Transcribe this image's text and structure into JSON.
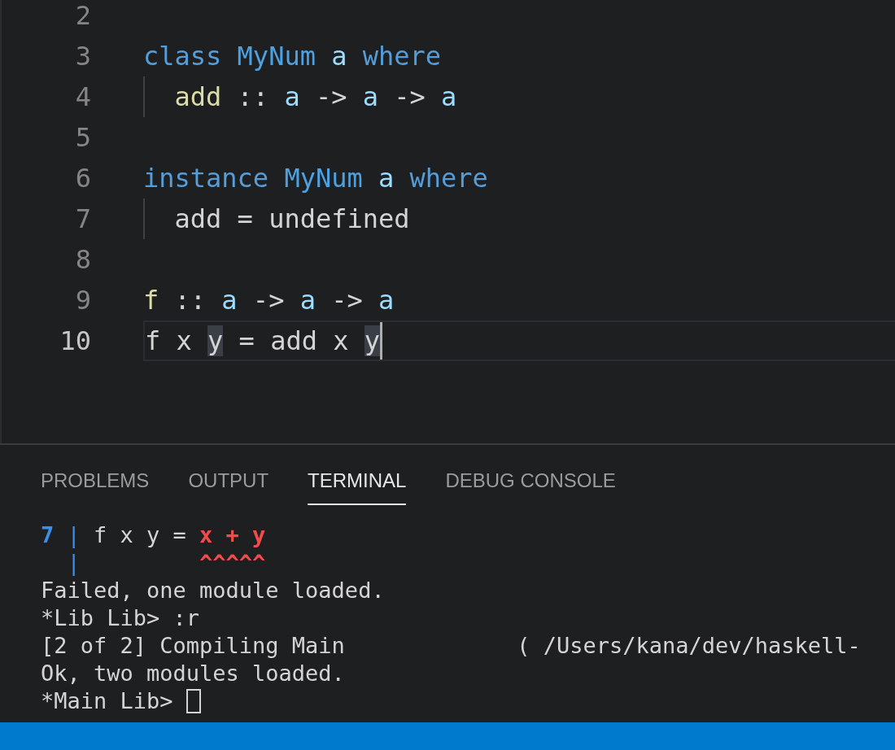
{
  "editor": {
    "lines": [
      {
        "number": "2",
        "current": false,
        "guide": false,
        "cursor": false
      },
      {
        "number": "3",
        "current": false,
        "guide": false,
        "cursor": false,
        "tokens": [
          {
            "text": "class ",
            "kind": "keyword",
            "highlight": false
          },
          {
            "text": "MyNum ",
            "kind": "type",
            "highlight": false
          },
          {
            "text": "a ",
            "kind": "var",
            "highlight": false
          },
          {
            "text": "where",
            "kind": "keyword",
            "highlight": false
          }
        ]
      },
      {
        "number": "4",
        "current": false,
        "guide": true,
        "cursor": false,
        "tokens": [
          {
            "text": "  add",
            "kind": "func",
            "highlight": false
          },
          {
            "text": " :: ",
            "kind": "plain",
            "highlight": false
          },
          {
            "text": "a",
            "kind": "var",
            "highlight": false
          },
          {
            "text": " -> ",
            "kind": "plain",
            "highlight": false
          },
          {
            "text": "a",
            "kind": "var",
            "highlight": false
          },
          {
            "text": " -> ",
            "kind": "plain",
            "highlight": false
          },
          {
            "text": "a",
            "kind": "var",
            "highlight": false
          }
        ]
      },
      {
        "number": "5",
        "current": false,
        "guide": false,
        "cursor": false
      },
      {
        "number": "6",
        "current": false,
        "guide": false,
        "cursor": false,
        "tokens": [
          {
            "text": "instance ",
            "kind": "keyword",
            "highlight": false
          },
          {
            "text": "MyNum ",
            "kind": "type",
            "highlight": false
          },
          {
            "text": "a ",
            "kind": "var",
            "highlight": false
          },
          {
            "text": "where",
            "kind": "keyword",
            "highlight": false
          }
        ]
      },
      {
        "number": "7",
        "current": false,
        "guide": true,
        "cursor": false,
        "tokens": [
          {
            "text": "  add = undefined",
            "kind": "plain",
            "highlight": false
          }
        ]
      },
      {
        "number": "8",
        "current": false,
        "guide": false,
        "cursor": false
      },
      {
        "number": "9",
        "current": false,
        "guide": false,
        "cursor": false,
        "tokens": [
          {
            "text": "f",
            "kind": "func",
            "highlight": false
          },
          {
            "text": " :: ",
            "kind": "plain",
            "highlight": false
          },
          {
            "text": "a",
            "kind": "var",
            "highlight": false
          },
          {
            "text": " -> ",
            "kind": "plain",
            "highlight": false
          },
          {
            "text": "a",
            "kind": "var",
            "highlight": false
          },
          {
            "text": " -> ",
            "kind": "plain",
            "highlight": false
          },
          {
            "text": "a",
            "kind": "var",
            "highlight": false
          }
        ]
      },
      {
        "number": "10",
        "current": true,
        "guide": false,
        "cursor": true,
        "tokens": [
          {
            "text": "f x ",
            "kind": "plain",
            "highlight": false
          },
          {
            "text": "y",
            "kind": "plain",
            "highlight": true
          },
          {
            "text": " = add x ",
            "kind": "plain",
            "highlight": false
          },
          {
            "text": "y",
            "kind": "plain",
            "highlight": true
          }
        ]
      }
    ]
  },
  "panel": {
    "tabs": [
      {
        "label": "PROBLEMS",
        "selected": false
      },
      {
        "label": "OUTPUT",
        "selected": false
      },
      {
        "label": "TERMINAL",
        "selected": true
      },
      {
        "label": "DEBUG CONSOLE",
        "selected": false
      }
    ],
    "terminal": {
      "lines": [
        {
          "tokens": [
            {
              "text": "7 ",
              "kind": "lineno"
            },
            {
              "text": "|",
              "kind": "pipe"
            },
            {
              "text": " f x y = ",
              "kind": "plain"
            },
            {
              "text": "x + y",
              "kind": "error"
            }
          ]
        },
        {
          "tokens": [
            {
              "text": "  |",
              "kind": "pipe"
            },
            {
              "text": "         ^^^^^",
              "kind": "error"
            }
          ]
        },
        {
          "tokens": [
            {
              "text": "Failed, one module loaded.",
              "kind": "plain"
            }
          ]
        },
        {
          "tokens": [
            {
              "text": "*Lib Lib> :r",
              "kind": "plain"
            }
          ]
        },
        {
          "tokens": [
            {
              "text": "[2 of 2] Compiling Main             ( /Users/kana/dev/haskell-",
              "kind": "plain"
            }
          ]
        },
        {
          "tokens": [
            {
              "text": "Ok, two modules loaded.",
              "kind": "plain"
            }
          ]
        },
        {
          "tokens": [
            {
              "text": "*Main Lib> ",
              "kind": "plain"
            }
          ],
          "cursor": true
        }
      ]
    }
  }
}
